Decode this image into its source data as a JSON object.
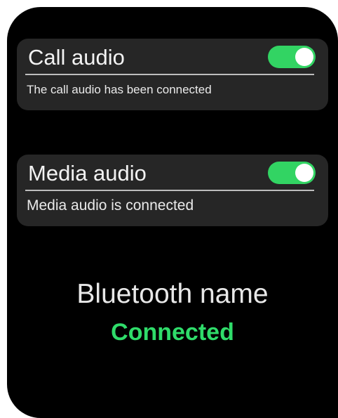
{
  "colors": {
    "screen_background": "#000000",
    "card_background": "#262626",
    "toggle_on": "#32d463",
    "connected_status": "#2fdc6a"
  },
  "call_audio": {
    "title": "Call audio",
    "subtitle": "The call audio has been connected",
    "toggle_state": "on"
  },
  "media_audio": {
    "title": "Media audio",
    "subtitle": "Media audio is connected",
    "toggle_state": "on"
  },
  "bluetooth": {
    "name": "Bluetooth name",
    "status": "Connected"
  }
}
